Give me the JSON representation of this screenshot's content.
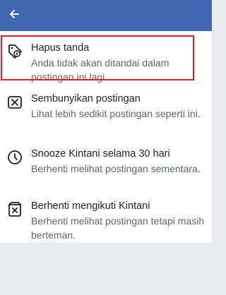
{
  "header": {
    "back_icon": "arrow-left-icon",
    "bg_color": "#4267b2"
  },
  "menu": {
    "items": [
      {
        "icon": "tag-remove-icon",
        "title": "Hapus tanda",
        "subtitle": "Anda tidak akan ditandai dalam postingan ini lagi."
      },
      {
        "icon": "close-box-icon",
        "title": "Sembunyikan postingan",
        "subtitle": "Lihat lebih sedikit postingan seperti ini."
      },
      {
        "icon": "clock-icon",
        "title": "Snooze Kintani selama 30 hari",
        "subtitle": "Berhenti melihat postingan sementara."
      },
      {
        "icon": "unfollow-icon",
        "title": "Berhenti mengikuti Kintani",
        "subtitle": "Berhenti melihat postingan tetapi masih berteman."
      }
    ]
  },
  "highlight_color": "#e11d2a"
}
